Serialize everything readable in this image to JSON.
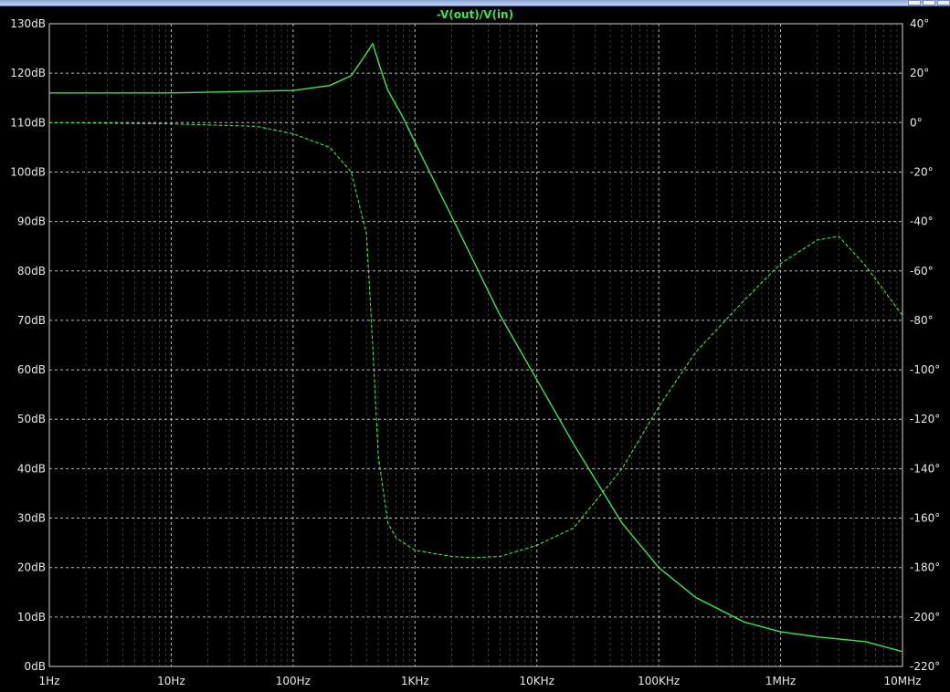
{
  "window": {
    "title": "-V(out)/V(in)"
  },
  "colors": {
    "background": "#000000",
    "plot_frame": "#d9d9d9",
    "major_grid": "#d0d0d0",
    "minor_grid": "#7f7f7f",
    "trace": "#39e84f",
    "text": "#e8e8e8"
  },
  "chart_data": {
    "type": "line",
    "title": "-V(out)/V(in)",
    "x_scale": "log",
    "x_label": "",
    "x_ticks": [
      "1Hz",
      "10Hz",
      "100Hz",
      "1KHz",
      "10KHz",
      "100KHz",
      "1MHz",
      "10MHz"
    ],
    "x_range": [
      1,
      10000000
    ],
    "left_axis": {
      "label": "",
      "ticks": [
        "130dB",
        "120dB",
        "110dB",
        "100dB",
        "90dB",
        "80dB",
        "70dB",
        "60dB",
        "50dB",
        "40dB",
        "30dB",
        "20dB",
        "10dB",
        "0dB"
      ],
      "range": [
        0,
        130
      ]
    },
    "right_axis": {
      "label": "",
      "ticks": [
        "40°",
        "20°",
        "0°",
        "-20°",
        "-40°",
        "-60°",
        "-80°",
        "-100°",
        "-120°",
        "-140°",
        "-160°",
        "-180°",
        "-200°",
        "-220°"
      ],
      "range": [
        -220,
        40
      ]
    },
    "grid": true,
    "series": [
      {
        "name": "",
        "style": "solid",
        "axis": "left",
        "x": [
          1,
          10,
          100,
          200,
          300,
          400,
          450,
          520,
          600,
          800,
          1000,
          2000,
          5000,
          10000,
          20000,
          50000,
          100000,
          200000,
          500000,
          1000000,
          2000000,
          5000000,
          10000000
        ],
        "y": [
          116,
          116,
          116.5,
          117.5,
          119.5,
          124,
          126,
          121,
          116.5,
          111,
          106,
          91,
          71,
          58,
          45,
          29,
          20,
          14,
          9,
          7,
          6,
          5,
          3
        ]
      },
      {
        "name": "",
        "style": "dashed",
        "axis": "right",
        "x": [
          1,
          10,
          50,
          100,
          200,
          300,
          400,
          450,
          500,
          600,
          700,
          1000,
          2000,
          3000,
          5000,
          10000,
          20000,
          50000,
          100000,
          200000,
          500000,
          1000000,
          2000000,
          3000000,
          5000000,
          10000000
        ],
        "y": [
          0,
          -0.5,
          -1.5,
          -4.5,
          -10,
          -20,
          -45,
          -90,
          -135,
          -162,
          -168,
          -173,
          -175.5,
          -176,
          -175.5,
          -171,
          -164,
          -140,
          -115,
          -93,
          -72,
          -57,
          -47.5,
          -46,
          -58,
          -78
        ]
      }
    ]
  }
}
